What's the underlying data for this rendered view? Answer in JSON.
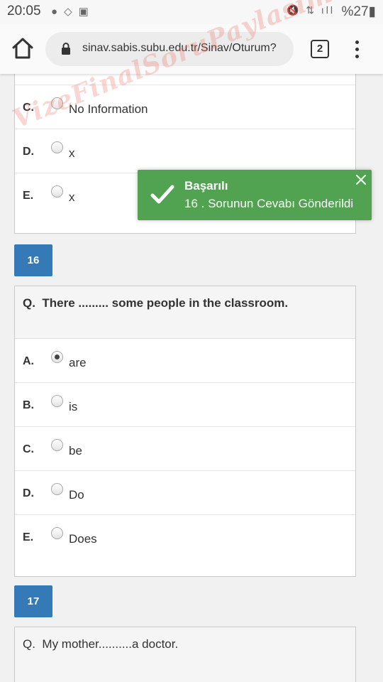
{
  "status_bar": {
    "time": "20:05",
    "battery": "%27",
    "icons": [
      "whatsapp-icon",
      "tag-icon",
      "image-icon",
      "mute-icon",
      "data-icon",
      "signal-icon",
      "battery-icon"
    ]
  },
  "browser": {
    "url": "sinav.sabis.subu.edu.tr/Sinav/Oturum?",
    "tab_count": "2"
  },
  "watermark": "VizeFinalSoruPaylasimi.com",
  "prev_question": {
    "options": [
      {
        "letter": "C.",
        "text": "No Information",
        "selected": false
      },
      {
        "letter": "D.",
        "text": "x",
        "selected": false
      },
      {
        "letter": "E.",
        "text": "x",
        "selected": false
      }
    ]
  },
  "toast": {
    "title": "Başarılı",
    "message": "16 . Sorunun Cevabı Gönderildi",
    "color": "#51a351"
  },
  "question16": {
    "number": "16",
    "prefix": "Q.",
    "text": "There ......... some people in the classroom.",
    "options": [
      {
        "letter": "A.",
        "text": "are",
        "selected": true
      },
      {
        "letter": "B.",
        "text": "is",
        "selected": false
      },
      {
        "letter": "C.",
        "text": "be",
        "selected": false
      },
      {
        "letter": "D.",
        "text": "Do",
        "selected": false
      },
      {
        "letter": "E.",
        "text": "Does",
        "selected": false
      }
    ]
  },
  "question17": {
    "number": "17",
    "prefix": "Q.",
    "text": "My mother..........a doctor."
  },
  "colors": {
    "question_number_bg": "#337ab7",
    "toast_bg": "#51a351"
  }
}
